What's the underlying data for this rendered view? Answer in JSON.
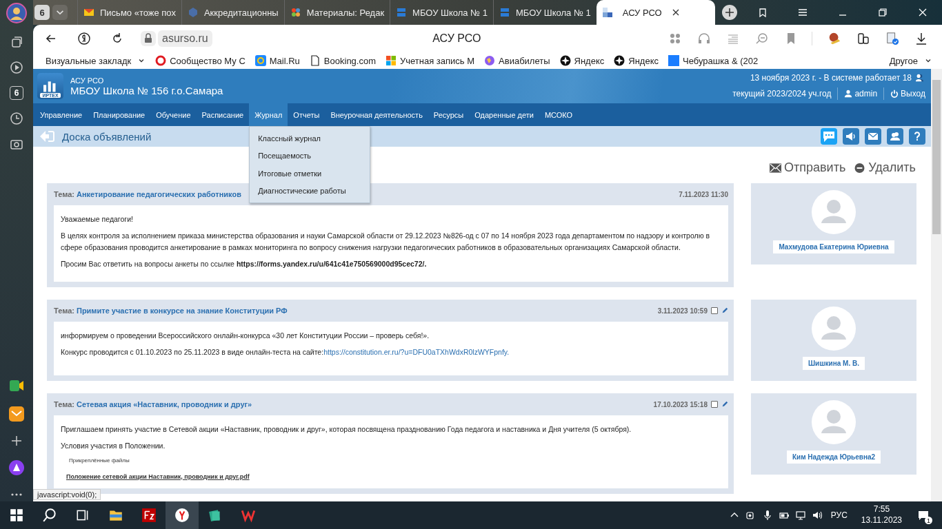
{
  "browser": {
    "rail_tab_count": "6",
    "tab_count": "6",
    "tabs": [
      {
        "title": "Письмо «тоже пох",
        "kind": "mail",
        "selected": false
      },
      {
        "title": "Аккредитационны",
        "kind": "emblem",
        "selected": false
      },
      {
        "title": "Материалы: Редак",
        "kind": "joomla",
        "selected": false
      },
      {
        "title": "МБОУ Школа № 1",
        "kind": "school",
        "selected": false
      },
      {
        "title": "МБОУ Школа № 1",
        "kind": "school",
        "selected": false
      },
      {
        "title": "АСУ РСО",
        "kind": "asu",
        "selected": true
      }
    ],
    "address": "asurso.ru",
    "page_title": "АСУ РСО",
    "bookmarks": [
      {
        "label": "Визуальные закладк",
        "kind": "folder"
      },
      {
        "label": "Сообщество Му С",
        "kind": "opera"
      },
      {
        "label": "Mail.Ru",
        "kind": "mailru"
      },
      {
        "label": "Booking.com",
        "kind": "page"
      },
      {
        "label": "Учетная запись М",
        "kind": "windows"
      },
      {
        "label": "Авиабилеты",
        "kind": "globe"
      },
      {
        "label": "Яндекс",
        "kind": "star"
      },
      {
        "label": "Яндекс",
        "kind": "star"
      },
      {
        "label": "Чебурашка & (202",
        "kind": "square"
      }
    ],
    "other": "Другое"
  },
  "site": {
    "logo_text": "ИРТЕХ",
    "brand": "АСУ РСО",
    "school": "МБОУ Школа № 156 г.о.Самара",
    "date_line": "13 ноября 2023 г. - В системе работает 18",
    "year": "текущий 2023/2024 уч.год",
    "user": "admin",
    "logout": "Выход"
  },
  "menu": [
    {
      "label": "Управление",
      "selected": false
    },
    {
      "label": "Планирование",
      "selected": false
    },
    {
      "label": "Обучение",
      "selected": false
    },
    {
      "label": "Расписание",
      "selected": false
    },
    {
      "label": "Журнал",
      "selected": true
    },
    {
      "label": "Отчеты",
      "selected": false
    },
    {
      "label": "Внеурочная деятельность",
      "selected": false
    },
    {
      "label": "Ресурсы",
      "selected": false
    },
    {
      "label": "Одаренные дети",
      "selected": false
    },
    {
      "label": "МСОКО",
      "selected": false
    }
  ],
  "dropdown": [
    "Классный журнал",
    "Посещаемость",
    "Итоговые отметки",
    "Диагностические работы"
  ],
  "page_title": "Доска объявлений",
  "actions": [
    {
      "label": "Отправить",
      "kind": "send"
    },
    {
      "label": "Удалить",
      "kind": "delete"
    }
  ],
  "posts": [
    {
      "topic_label": "Тема:",
      "topic": "Анкетирование педагогических работников",
      "date": "7.11.2023 11:30",
      "editable": false,
      "author": "Махмудова Екатерина Юриевна",
      "paragraphs": [
        {
          "text": "Уважаемые педагоги!"
        },
        {
          "text": "В целях контроля за исполнением приказа министерства образования и науки Самарской области от 29.12.2023 №826-од с 07 по 14 ноября 2023 года департаментом по надзору и контролю в сфере образования проводится анкетирование в рамках мониторинга по вопросу снижения нагрузки педагогических работников в образовательных организациях Самарской области."
        },
        {
          "text": "Просим Вас ответить на вопросы анкеты по ссылке **https://forms.yandex.ru/u/641c41e750569000d95cec72/.**"
        }
      ]
    },
    {
      "topic_label": "Тема:",
      "topic": "Примите участие в конкурсе на знание Конституции РФ",
      "date": "3.11.2023 10:59",
      "editable": true,
      "checked": false,
      "author": "Шишкина М. В.",
      "paragraphs": [
        {
          "text": "информируем о проведении Всероссийского онлайн-конкурса «30 лет Конституции России – проверь себя!»."
        },
        {
          "text": "Конкурс проводится с 01.10.2023 по 25.11.2023 в виде онлайн-теста на сайте:",
          "link": "https://constitution.er.ru/?u=DFU0aTXhWdxR0lzWYFpnfy."
        }
      ]
    },
    {
      "topic_label": "Тема:",
      "topic": "Сетевая акция «Наставник, проводник и друг»",
      "date": "17.10.2023 15:18",
      "editable": true,
      "checked": false,
      "author": "Ким Надежда Юрьевна2",
      "paragraphs": [
        {
          "text": "Приглашаем принять участие в Сетевой акции «Наставник, проводник и друг», которая посвящена празднованию Года педагога и наставника и Дня учителя (5 октября)."
        },
        {
          "text": "Условия участия в Положении."
        }
      ],
      "attachments_label": "Прикреплённые файлы",
      "attachment": "Положение сетевой акции Наставник, проводник и друг.pdf"
    }
  ],
  "status_text": "javascript:void(0);",
  "taskbar": {
    "lang": "РУС",
    "time": "7:55",
    "date": "13.11.2023",
    "notifications": "1"
  }
}
